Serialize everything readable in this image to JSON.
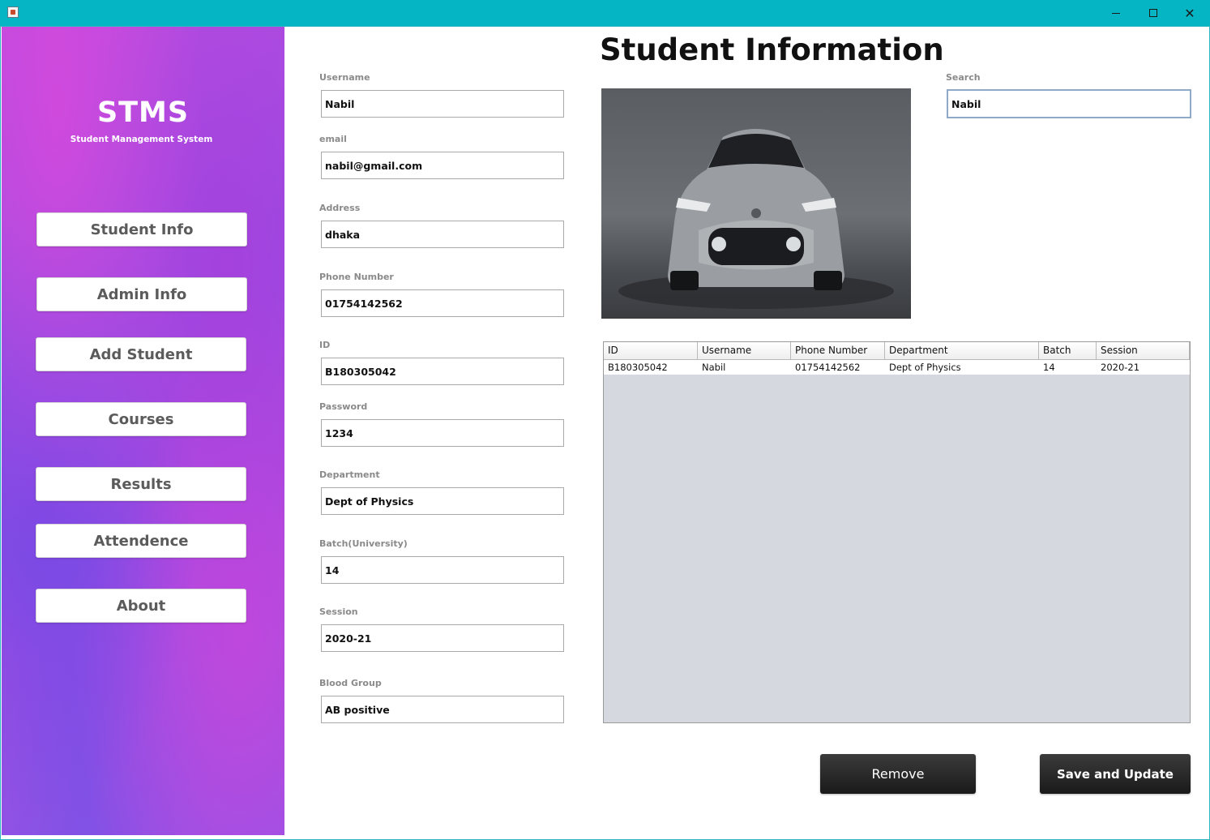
{
  "window": {
    "title": "",
    "controls": {
      "minimize": "minimize",
      "maximize": "maximize",
      "close": "close"
    }
  },
  "sidebar": {
    "logo": "STMS",
    "subtitle": "Student Management System",
    "items": [
      {
        "label": "Student Info"
      },
      {
        "label": "Admin Info"
      },
      {
        "label": "Add Student"
      },
      {
        "label": "Courses"
      },
      {
        "label": "Results"
      },
      {
        "label": "Attendence"
      },
      {
        "label": "About"
      }
    ]
  },
  "main": {
    "title": "Student Information",
    "fields": [
      {
        "label": "Username",
        "value": "Nabil"
      },
      {
        "label": "email",
        "value": "nabil@gmail.com"
      },
      {
        "label": "Address",
        "value": "dhaka"
      },
      {
        "label": "Phone Number",
        "value": "01754142562"
      },
      {
        "label": "ID",
        "value": "B180305042"
      },
      {
        "label": "Password",
        "value": "1234"
      },
      {
        "label": "Department",
        "value": "Dept of Physics"
      },
      {
        "label": "Batch(University)",
        "value": "14"
      },
      {
        "label": "Session",
        "value": "2020-21"
      },
      {
        "label": "Blood Group",
        "value": "AB positive"
      }
    ],
    "search": {
      "label": "Search",
      "value": "Nabil"
    },
    "photo": {
      "subject": "car-photo"
    },
    "table": {
      "columns": [
        "ID",
        "Username",
        "Phone Number",
        "Department",
        "Batch",
        "Session"
      ],
      "rows": [
        [
          "B180305042",
          "Nabil",
          "01754142562",
          "Dept of Physics",
          "14",
          "2020-21"
        ]
      ]
    },
    "buttons": {
      "remove": "Remove",
      "save": "Save and Update"
    }
  },
  "colors": {
    "titlebar": "#05b5c4",
    "sidebar_primary": "#a54ee0",
    "button_dark": "#1f1f1f"
  }
}
